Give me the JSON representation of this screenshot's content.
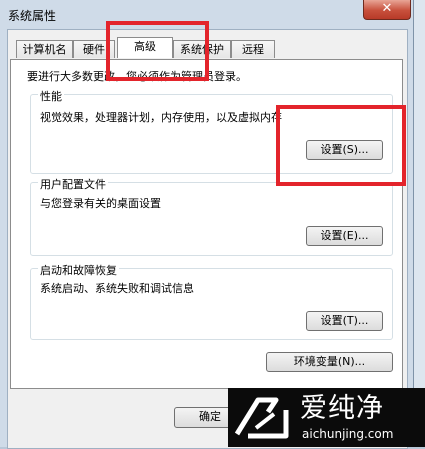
{
  "window": {
    "title": "系统属性",
    "close_glyph": "✕"
  },
  "tabs": [
    {
      "label": "计算机名"
    },
    {
      "label": "硬件"
    },
    {
      "label": "高级",
      "active": true
    },
    {
      "label": "系统保护"
    },
    {
      "label": "远程"
    }
  ],
  "notice": "要进行大多数更改，您必须作为管理员登录。",
  "performance": {
    "title": "性能",
    "description": "视觉效果，处理器计划，内存使用，以及虚拟内存",
    "button": "设置(S)..."
  },
  "user_profiles": {
    "title": "用户配置文件",
    "description": "与您登录有关的桌面设置",
    "button": "设置(E)..."
  },
  "startup_recovery": {
    "title": "启动和故障恢复",
    "description": "系统启动、系统失败和调试信息",
    "button": "设置(T)..."
  },
  "env_button": "环境变量(N)...",
  "ok_button": "确定",
  "watermark": {
    "name": "爱纯净",
    "url": "aichunjing.com"
  },
  "highlight_color": "#e3242b"
}
